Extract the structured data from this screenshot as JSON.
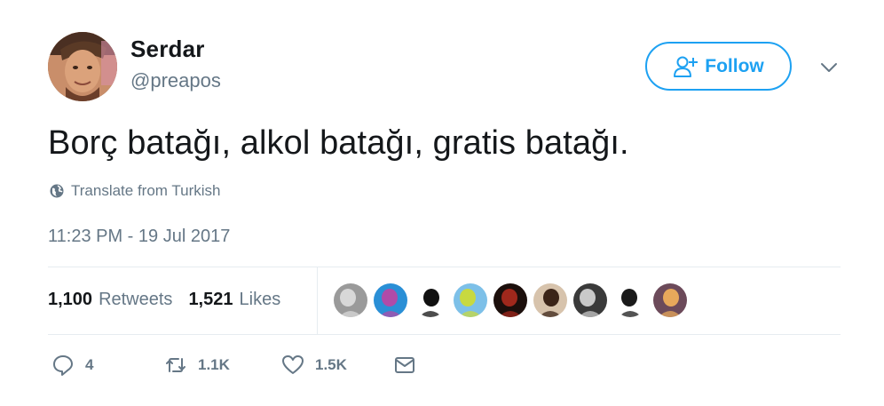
{
  "author": {
    "display_name": "Serdar",
    "handle": "@preapos",
    "avatar_icon": "user-avatar"
  },
  "follow_button": {
    "label": "Follow",
    "icon": "add-user-icon",
    "color": "#1da1f2"
  },
  "menu": {
    "icon": "chevron-down-icon"
  },
  "tweet": {
    "text": "Borç batağı, alkol batağı, gratis batağı.",
    "translate_label": "Translate from Turkish",
    "timestamp": "11:23 PM - 19 Jul 2017"
  },
  "stats": {
    "retweets_count": "1,100",
    "retweets_label": "Retweets",
    "likes_count": "1,521",
    "likes_label": "Likes"
  },
  "likers": [
    {
      "icon": "liker-avatar-1",
      "bg": "#9a9a9a",
      "fg": "#d8d8d8"
    },
    {
      "icon": "liker-avatar-2",
      "bg": "#2a8fd6",
      "fg": "#b04ba8"
    },
    {
      "icon": "liker-avatar-3",
      "bg": "#ffffff",
      "fg": "#111111"
    },
    {
      "icon": "liker-avatar-4",
      "bg": "#7dc0e8",
      "fg": "#c8d940"
    },
    {
      "icon": "liker-avatar-5",
      "bg": "#1c0f0c",
      "fg": "#a0281c"
    },
    {
      "icon": "liker-avatar-6",
      "bg": "#d7c3ac",
      "fg": "#3b2418"
    },
    {
      "icon": "liker-avatar-7",
      "bg": "#3a3a3a",
      "fg": "#c9c9c9"
    },
    {
      "icon": "liker-avatar-8",
      "bg": "#ffffff",
      "fg": "#1a1a1a"
    },
    {
      "icon": "liker-avatar-9",
      "bg": "#6c4a5a",
      "fg": "#e7a85b"
    }
  ],
  "actions": {
    "reply_count": "4",
    "retweet_count": "1.1K",
    "like_count": "1.5K"
  },
  "colors": {
    "text_primary": "#14171a",
    "text_secondary": "#657786",
    "divider": "#e6ecf0",
    "accent": "#1da1f2"
  }
}
